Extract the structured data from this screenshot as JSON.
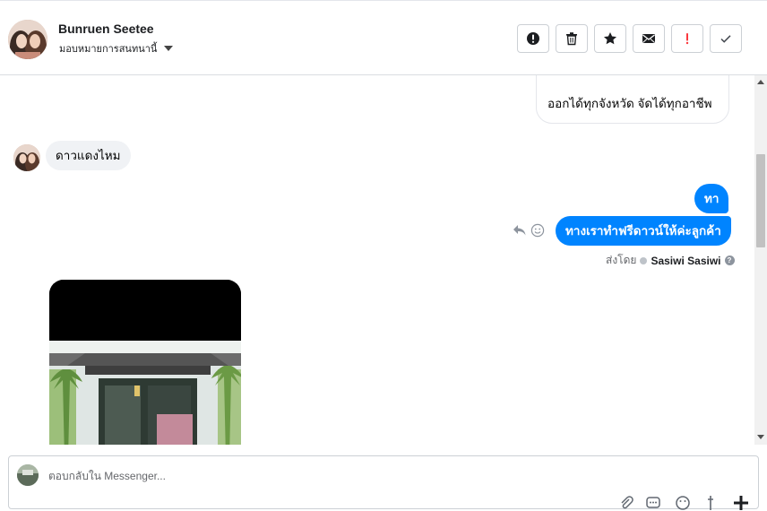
{
  "header": {
    "contact_name": "Bunruen Seetee",
    "assign_label": "มอบหมายการสนทนานี้",
    "actions": [
      {
        "name": "report-spam",
        "icon": "exclamation-circle-icon"
      },
      {
        "name": "delete",
        "icon": "trash-icon"
      },
      {
        "name": "star",
        "icon": "star-icon"
      },
      {
        "name": "mark-unread",
        "icon": "envelope-icon"
      },
      {
        "name": "follow-up",
        "icon": "exclamation-icon",
        "color": "#fa383e"
      },
      {
        "name": "mark-done",
        "icon": "check-icon"
      }
    ]
  },
  "messages": {
    "outgoing_partial": "ออกได้ทุกจังหวัด จัดได้ทุกอาชีพ",
    "incoming_1": "ดาวแดงไหม",
    "outgoing_1": "ทา",
    "outgoing_2": "ทางเราทำฟรีดาวน์ให้ค่ะลูกค้า",
    "sent_by_label": "ส่งโดย",
    "sent_by_name": "Sasiwi Sasiwi"
  },
  "composer": {
    "placeholder": "ตอบกลับใน Messenger..."
  },
  "colors": {
    "accent": "#0084ff",
    "incoming_bubble": "#f0f2f5",
    "follow_up": "#fa383e"
  }
}
